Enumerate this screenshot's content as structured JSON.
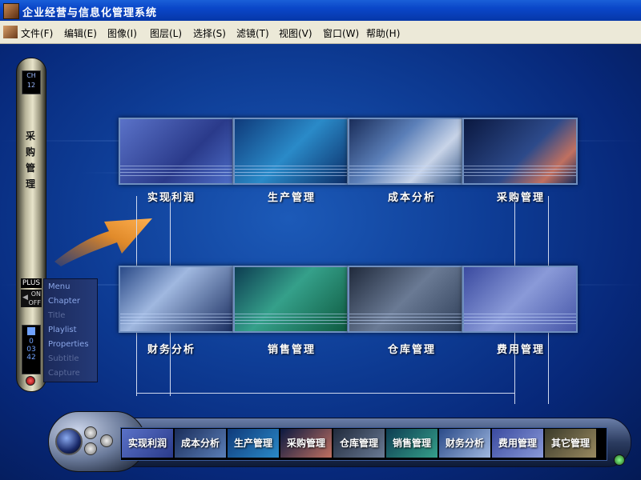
{
  "window": {
    "title": "企业经营与信息化管理系统"
  },
  "menu": [
    "文件(F)",
    "编辑(E)",
    "图像(I)",
    "图层(L)",
    "选择(S)",
    "滤镜(T)",
    "视图(V)",
    "窗口(W)",
    "帮助(H)"
  ],
  "modules_top": [
    "实现利润",
    "生产管理",
    "成本分析",
    "采购管理"
  ],
  "modules_bottom": [
    "财务分析",
    "销售管理",
    "仓库管理",
    "费用管理"
  ],
  "remote": {
    "ch_label": "CH",
    "ch_number": "12",
    "title": "采购管理",
    "plus": "PLUS",
    "on": "ON",
    "off": "OFF",
    "counter": [
      "0",
      "03",
      "42"
    ],
    "menu_items": [
      "Menu",
      "Chapter",
      "Title",
      "Playlist",
      "Properties",
      "Subtitle",
      "Capture"
    ]
  },
  "bottom_tabs": [
    "实现利润",
    "成本分析",
    "生产管理",
    "采购管理",
    "仓库管理",
    "销售管理",
    "财务分析",
    "费用管理",
    "其它管理"
  ],
  "colors": {
    "background": "#0e3d96",
    "titlebar": "#0a46c8",
    "menubar": "#ece9d8"
  },
  "icons": {
    "app": "app-icon",
    "arrow": "orange-arrow"
  }
}
